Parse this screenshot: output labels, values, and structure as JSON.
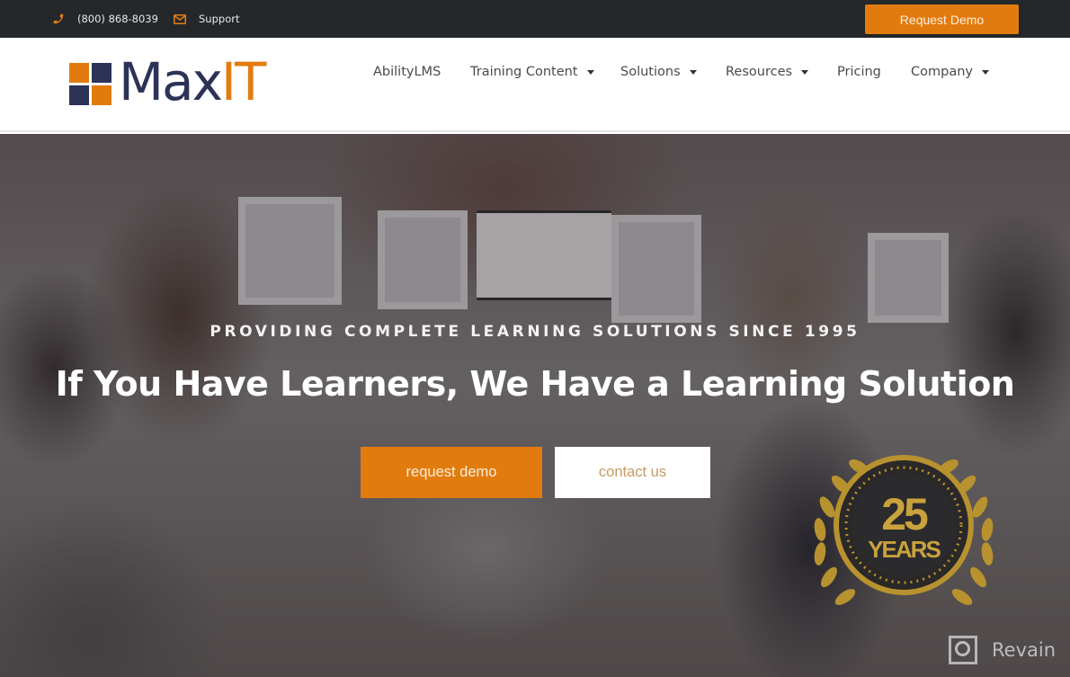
{
  "topbar": {
    "phone": "(800) 868-8039",
    "phone_icon": "phone-icon",
    "support": "Support",
    "support_icon": "envelope-icon",
    "request_demo": "Request Demo"
  },
  "brand": {
    "name_part1": "Max",
    "name_part2": "IT",
    "colors": {
      "navy": "#2c3357",
      "orange": "#e27b0d"
    }
  },
  "nav": {
    "items": [
      {
        "label": "AbilityLMS",
        "dropdown": false
      },
      {
        "label": "Training Content",
        "dropdown": true
      },
      {
        "label": "Solutions",
        "dropdown": true
      },
      {
        "label": "Resources",
        "dropdown": true
      },
      {
        "label": "Pricing",
        "dropdown": false
      },
      {
        "label": "Company",
        "dropdown": true
      }
    ]
  },
  "hero": {
    "tagline": "PROVIDING COMPLETE LEARNING SOLUTIONS SINCE 1995",
    "headline": "If You Have Learners, We Have a Learning Solution",
    "primary_button": "request demo",
    "secondary_button": "contact us",
    "badge": {
      "number": "25",
      "label": "YEARS"
    }
  },
  "watermark": {
    "text": "Revain"
  }
}
